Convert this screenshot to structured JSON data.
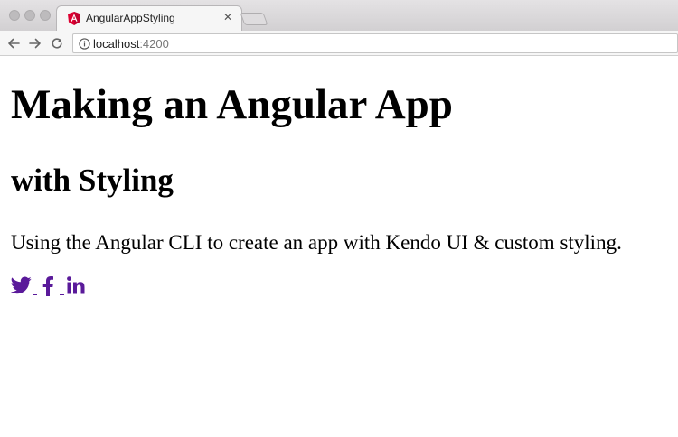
{
  "browser": {
    "tab": {
      "title": "AngularAppStyling",
      "close_glyph": "✕",
      "favicon": "angular-logo-icon"
    },
    "address": {
      "host": "localhost",
      "port": ":4200",
      "info_icon": "info-icon"
    },
    "nav_icons": [
      "back-arrow-icon",
      "forward-arrow-icon",
      "reload-icon"
    ]
  },
  "page": {
    "heading": "Making an Angular App",
    "subheading": "with Styling",
    "description": "Using the Angular CLI to create an app with Kendo UI & custom styling.",
    "social_links": [
      "twitter-icon",
      "facebook-icon",
      "linkedin-icon"
    ]
  },
  "colors": {
    "social": "#5a1a9a",
    "angular_red": "#dd0031"
  }
}
